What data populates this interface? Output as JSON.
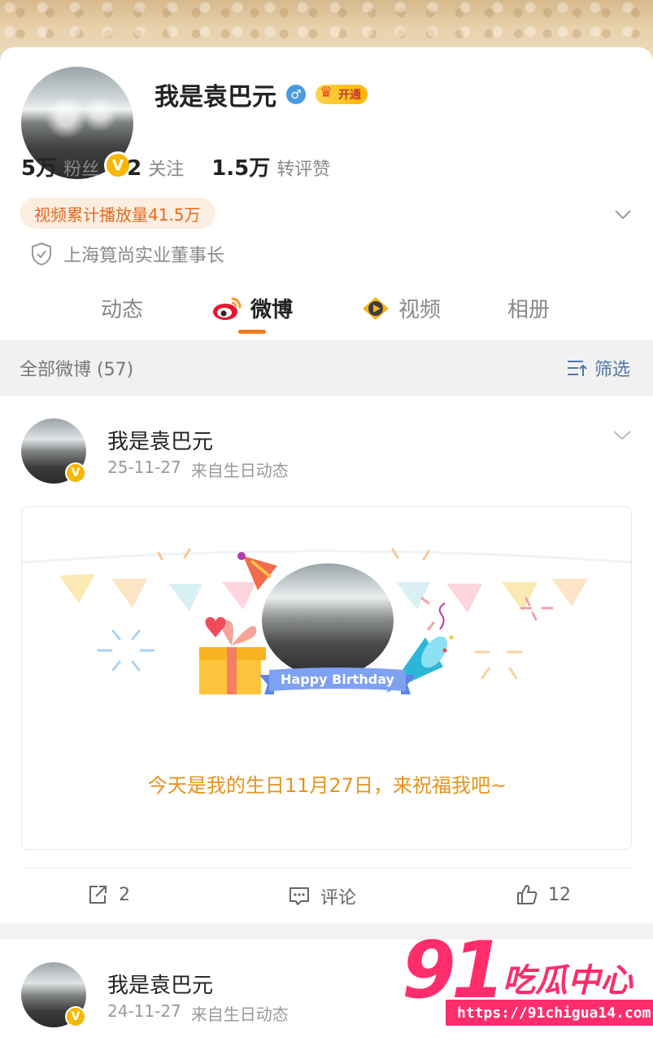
{
  "profile": {
    "name": "我是袁巴元",
    "gender_icon": "♂",
    "vip_label": "开通",
    "v_badge": "V",
    "stats": [
      {
        "num": "5万",
        "label": "粉丝"
      },
      {
        "num": "2",
        "label": "关注"
      },
      {
        "num": "1.5万",
        "label": "转评赞"
      }
    ],
    "video_plays": "视频累计播放量41.5万",
    "certification": "上海筧尚实业董事长"
  },
  "tabs": [
    {
      "label": "动态",
      "active": false
    },
    {
      "label": "微博",
      "active": true
    },
    {
      "label": "视频",
      "active": false
    },
    {
      "label": "相册",
      "active": false
    }
  ],
  "filter": {
    "title": "全部微博 (57)",
    "button": "筛选"
  },
  "post": {
    "author": "我是袁巴元",
    "date": "25-11-27",
    "source": "来自生日动态",
    "ribbon_text": "Happy Birthday",
    "message": "今天是我的生日11月27日，来祝福我吧~",
    "actions": {
      "repost_count": "2",
      "comment_label": "评论",
      "like_count": "12"
    }
  },
  "post2": {
    "author": "我是袁巴元",
    "date": "24-11-27",
    "source": "来自生日动态"
  },
  "watermark": {
    "number": "91",
    "text": "吃瓜中心",
    "url": "https://91chigua14.com"
  },
  "colors": {
    "accent_orange": "#f07d20",
    "link_blue": "#4c77a8",
    "birthday_text": "#e8921d",
    "watermark_pink": "#ff2d6b"
  }
}
